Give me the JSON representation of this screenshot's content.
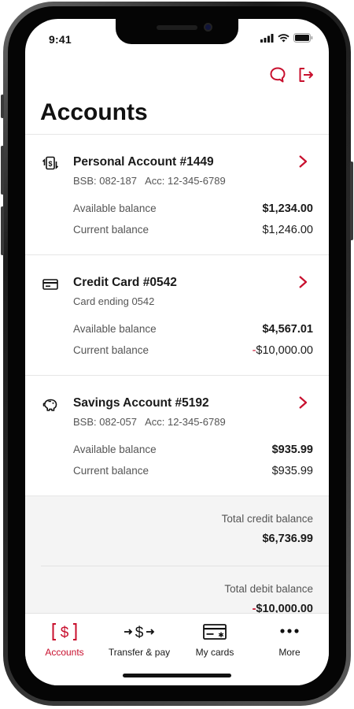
{
  "status_bar": {
    "time": "9:41"
  },
  "page": {
    "title": "Accounts"
  },
  "colors": {
    "accent": "#c8102e",
    "text": "#1a1a1a",
    "muted": "#555555",
    "totals_bg": "#f4f4f4"
  },
  "accounts": [
    {
      "icon": "transfer-dollar-icon",
      "name": "Personal Account #1449",
      "subtitle": "BSB: 082-187   Acc: 12-345-6789",
      "available_label": "Available balance",
      "available_value": "$1,234.00",
      "current_label": "Current balance",
      "current_value": "$1,246.00"
    },
    {
      "icon": "credit-card-icon",
      "name": "Credit Card #0542",
      "subtitle": "Card ending 0542",
      "available_label": "Available balance",
      "available_value": "$4,567.01",
      "current_label": "Current balance",
      "current_sign": "-",
      "current_value": "$10,000.00"
    },
    {
      "icon": "piggy-bank-icon",
      "name": "Savings Account #5192",
      "subtitle": "BSB: 082-057   Acc: 12-345-6789",
      "available_label": "Available balance",
      "available_value": "$935.99",
      "current_label": "Current balance",
      "current_value": "$935.99"
    }
  ],
  "totals": {
    "credit_label": "Total credit balance",
    "credit_value": "$6,736.99",
    "debit_label": "Total debit balance",
    "debit_sign": "-",
    "debit_value": "$10,000.00"
  },
  "tabs": [
    {
      "label": "Accounts",
      "icon": "accounts-dollar-icon",
      "active": true
    },
    {
      "label": "Transfer & pay",
      "icon": "transfer-pay-icon",
      "active": false
    },
    {
      "label": "My cards",
      "icon": "cards-icon",
      "active": false
    },
    {
      "label": "More",
      "icon": "more-dots-icon",
      "active": false
    }
  ]
}
